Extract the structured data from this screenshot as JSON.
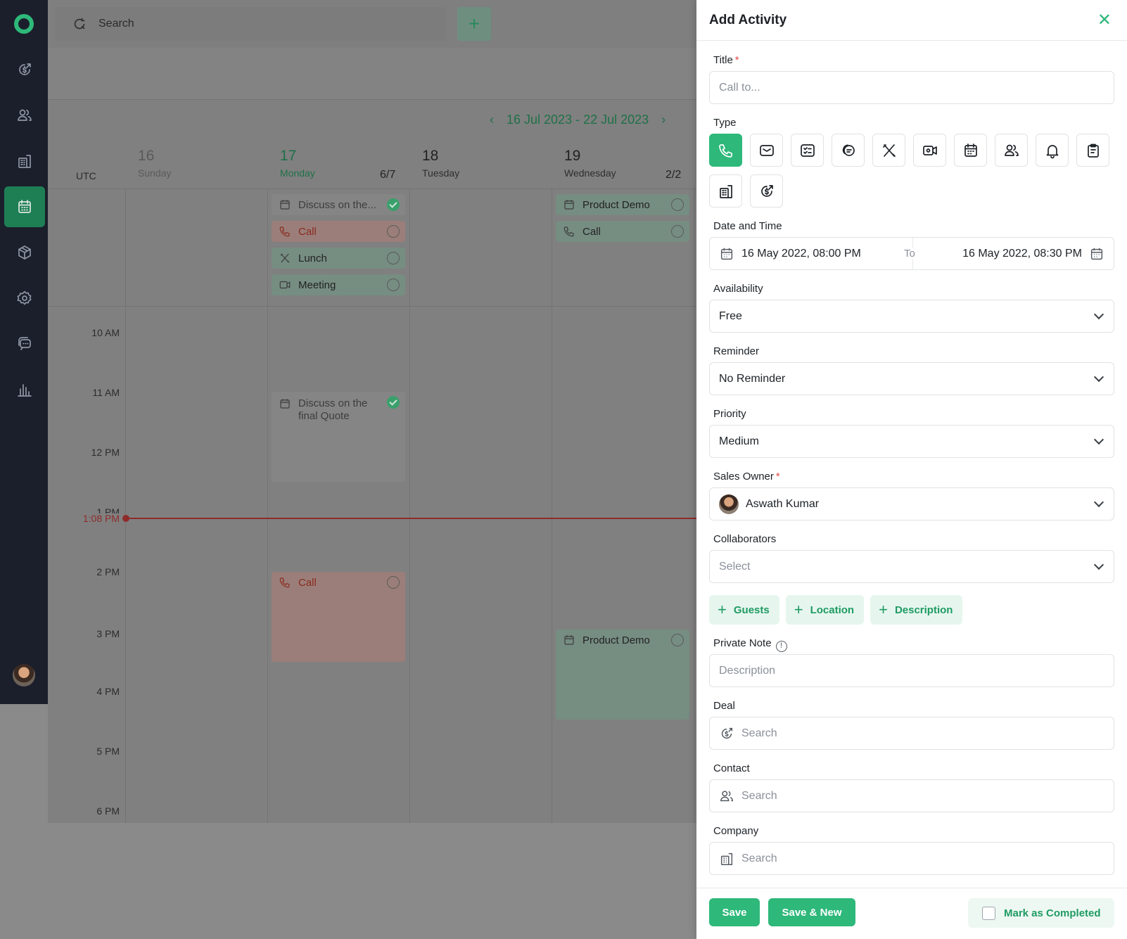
{
  "topbar": {
    "search_placeholder": "Search",
    "add_label": "+"
  },
  "calendar": {
    "range_label": "16 Jul 2023 - 22 Jul 2023",
    "timezone": "UTC",
    "days": [
      {
        "num": "16",
        "name": "Sunday",
        "count": ""
      },
      {
        "num": "17",
        "name": "Monday",
        "count": "6/7"
      },
      {
        "num": "18",
        "name": "Tuesday",
        "count": ""
      },
      {
        "num": "19",
        "name": "Wednesday",
        "count": "2/2"
      }
    ],
    "hours": [
      "10 AM",
      "11 AM",
      "12 PM",
      "1 PM",
      "2 PM",
      "3 PM",
      "4 PM",
      "5 PM",
      "6 PM"
    ],
    "now_label": "1:08 PM",
    "allday_monday": [
      {
        "label": "Discuss on the...",
        "done": true
      },
      {
        "label": "Call",
        "done": false
      },
      {
        "label": "Lunch",
        "done": false
      },
      {
        "label": "Meeting",
        "done": false
      }
    ],
    "allday_wednesday": [
      {
        "label": "Product Demo",
        "done": false
      },
      {
        "label": "Call",
        "done": false
      }
    ],
    "timed": {
      "discuss_quote": "Discuss on the final Quote",
      "call": "Call",
      "product_demo": "Product Demo"
    }
  },
  "panel": {
    "title": "Add Activity",
    "title_label": "Title",
    "title_placeholder": "Call to...",
    "type_label": "Type",
    "types": [
      "phone-icon",
      "mail-icon",
      "task-icon",
      "chat-icon",
      "lunch-icon",
      "video-icon",
      "calendar-icon",
      "contacts-icon",
      "bell-icon",
      "clipboard-icon",
      "building-icon",
      "deal-icon"
    ],
    "date_label": "Date and Time",
    "date_from": "16 May 2022, 08:00 PM",
    "date_to_label": "To",
    "date_to": "16 May 2022, 08:30 PM",
    "availability_label": "Availability",
    "availability_value": "Free",
    "reminder_label": "Reminder",
    "reminder_value": "No Reminder",
    "priority_label": "Priority",
    "priority_value": "Medium",
    "owner_label": "Sales Owner",
    "owner_value": "Aswath Kumar",
    "collaborators_label": "Collaborators",
    "collaborators_placeholder": "Select",
    "chips": [
      "Guests",
      "Location",
      "Description"
    ],
    "private_note_label": "Private Note",
    "private_note_placeholder": "Description",
    "deal_label": "Deal",
    "deal_placeholder": "Search",
    "contact_label": "Contact",
    "contact_placeholder": "Search",
    "company_label": "Company",
    "company_placeholder": "Search",
    "save": "Save",
    "save_new": "Save & New",
    "mark_completed": "Mark as Completed",
    "required_mark": "*",
    "info_mark": "!",
    "close_glyph": "✕"
  },
  "colors": {
    "accent": "#2eb87a",
    "sidebar": "#1b1f2b"
  }
}
